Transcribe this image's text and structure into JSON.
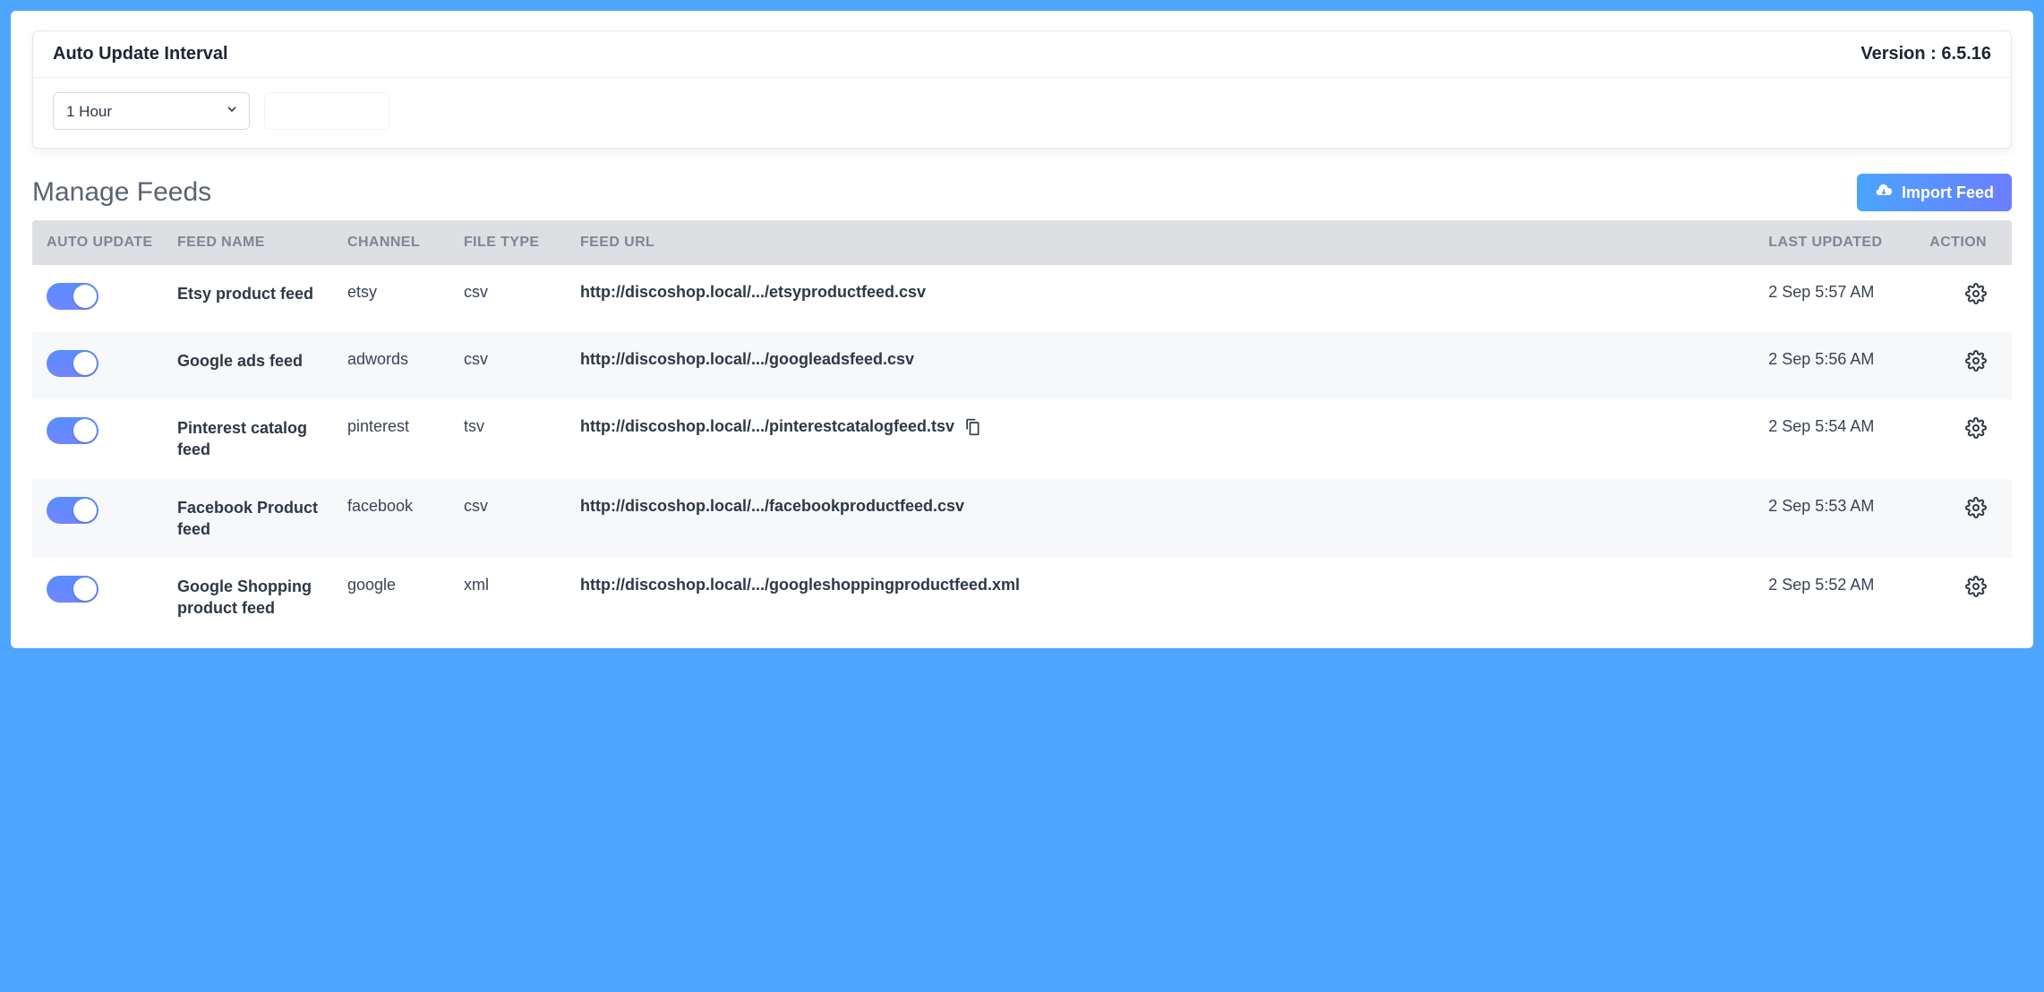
{
  "panel": {
    "title": "Auto Update Interval",
    "version_label": "Version : ",
    "version": "6.5.16",
    "interval_value": "1 Hour"
  },
  "section": {
    "title": "Manage Feeds",
    "import_label": "Import Feed"
  },
  "columns": {
    "auto": "AUTO UPDATE",
    "name": "FEED NAME",
    "channel": "CHANNEL",
    "ftype": "FILE TYPE",
    "url": "FEED URL",
    "updated": "LAST UPDATED",
    "action": "ACTION"
  },
  "feeds": [
    {
      "auto": true,
      "name": "Etsy product feed",
      "channel": "etsy",
      "ftype": "csv",
      "url": "http://discoshop.local/.../etsyproductfeed.csv",
      "updated": "2 Sep 5:57 AM",
      "show_copy": false
    },
    {
      "auto": true,
      "name": "Google ads feed",
      "channel": "adwords",
      "ftype": "csv",
      "url": "http://discoshop.local/.../googleadsfeed.csv",
      "updated": "2 Sep 5:56 AM",
      "show_copy": false
    },
    {
      "auto": true,
      "name": "Pinterest catalog feed",
      "channel": "pinterest",
      "ftype": "tsv",
      "url": "http://discoshop.local/.../pinterestcatalogfeed.tsv",
      "updated": "2 Sep 5:54 AM",
      "show_copy": true
    },
    {
      "auto": true,
      "name": "Facebook Product feed",
      "channel": "facebook",
      "ftype": "csv",
      "url": "http://discoshop.local/.../facebookproductfeed.csv",
      "updated": "2 Sep 5:53 AM",
      "show_copy": false
    },
    {
      "auto": true,
      "name": "Google Shopping product feed",
      "channel": "google",
      "ftype": "xml",
      "url": "http://discoshop.local/.../googleshoppingproductfeed.xml",
      "updated": "2 Sep 5:52 AM",
      "show_copy": false
    }
  ]
}
